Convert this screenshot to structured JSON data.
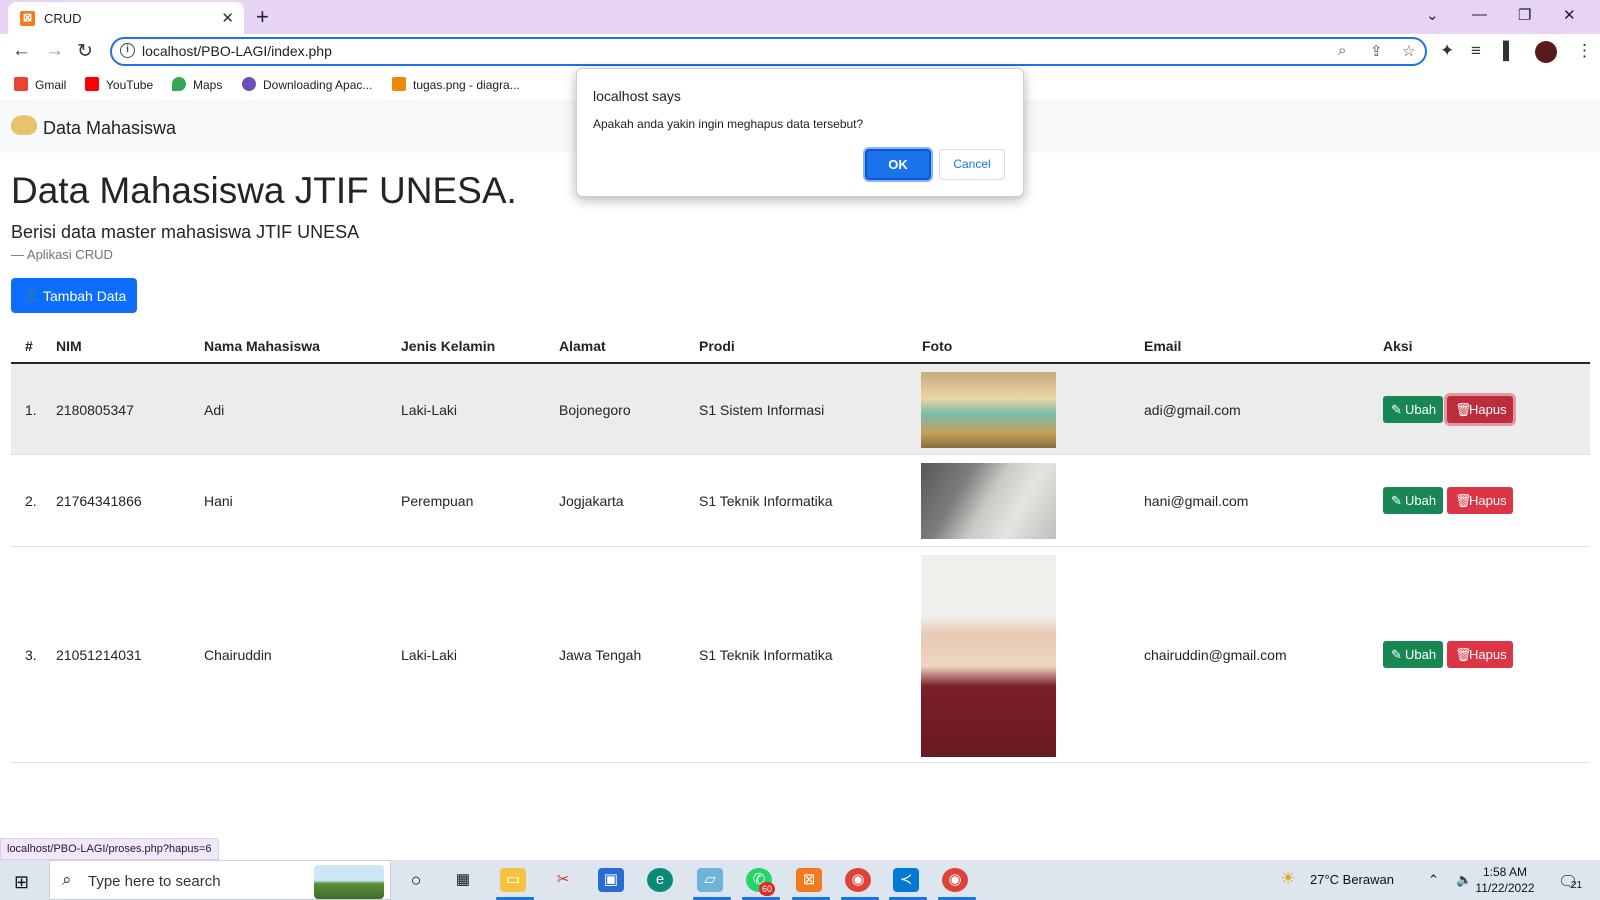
{
  "browser": {
    "tab_title": "CRUD",
    "url": "localhost/PBO-LAGI/index.php",
    "bookmarks": [
      "Gmail",
      "YouTube",
      "Maps",
      "Downloading Apac...",
      "tugas.png - diagra..."
    ],
    "status_url": "localhost/PBO-LAGI/proses.php?hapus=6"
  },
  "navbar": {
    "brand": "Data Mahasiswa"
  },
  "page": {
    "title": "Data Mahasiswa JTIF UNESA.",
    "lead": "Berisi data master mahasiswa JTIF UNESA",
    "footer": "— Aplikasi CRUD",
    "add_button": "Tambah Data"
  },
  "table": {
    "headers": [
      "#",
      "NIM",
      "Nama Mahasiswa",
      "Jenis Kelamin",
      "Alamat",
      "Prodi",
      "Foto",
      "Email",
      "Aksi"
    ],
    "rows": [
      {
        "no": "1.",
        "nim": "2180805347",
        "nama": "Adi",
        "jk": "Laki-Laki",
        "alamat": "Bojonegoro",
        "prodi": "S1 Sistem Informasi",
        "email": "adi@gmail.com"
      },
      {
        "no": "2.",
        "nim": "21764341866",
        "nama": "Hani",
        "jk": "Perempuan",
        "alamat": "Jogjakarta",
        "prodi": "S1 Teknik Informatika",
        "email": "hani@gmail.com"
      },
      {
        "no": "3.",
        "nim": "21051214031",
        "nama": "Chairuddin",
        "jk": "Laki-Laki",
        "alamat": "Jawa Tengah",
        "prodi": "S1 Teknik Informatika",
        "email": "chairuddin@gmail.com"
      }
    ],
    "edit_label": "Ubah",
    "delete_label": "Hapus"
  },
  "dialog": {
    "title": "localhost says",
    "message": "Apakah anda yakin ingin meghapus data tersebut?",
    "ok": "OK",
    "cancel": "Cancel"
  },
  "taskbar": {
    "search_placeholder": "Type here to search",
    "weather": "27°C  Berawan",
    "time": "1:58 AM",
    "date": "11/22/2022",
    "notifications": "21",
    "whatsapp_badge": "60"
  }
}
